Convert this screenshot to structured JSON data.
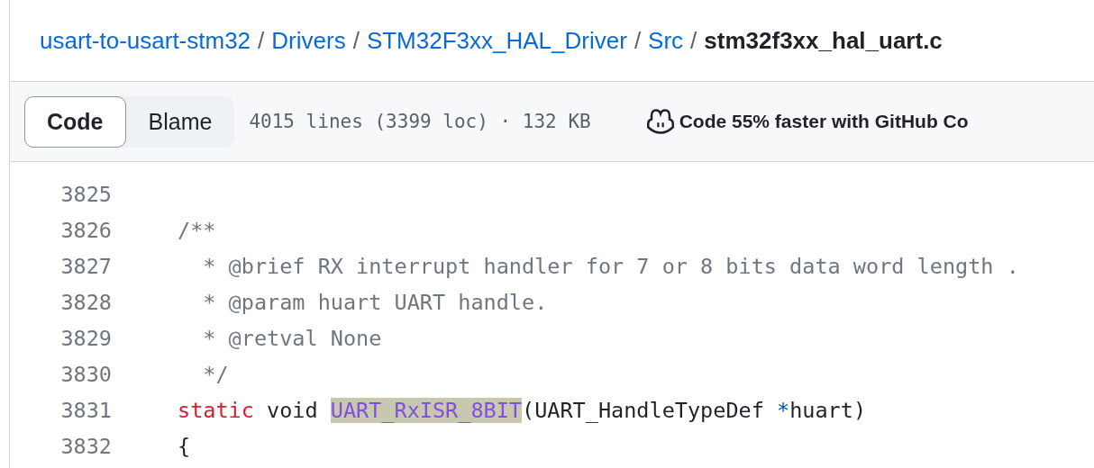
{
  "breadcrumb": [
    {
      "label": "usart-to-usart-stm32",
      "kind": "link"
    },
    {
      "label": "Drivers",
      "kind": "link"
    },
    {
      "label": "STM32F3xx_HAL_Driver",
      "kind": "link"
    },
    {
      "label": "Src",
      "kind": "link"
    },
    {
      "label": "stm32f3xx_hal_uart.c",
      "kind": "current"
    }
  ],
  "breadcrumb_separator": "/",
  "view_tabs": [
    {
      "label": "Code",
      "selected": true
    },
    {
      "label": "Blame",
      "selected": false
    }
  ],
  "file_info": "4015 lines (3399 loc) · 132 KB",
  "copilot_promo": "Code 55% faster with GitHub Co",
  "code_lines": [
    {
      "number": "3825"
    },
    {
      "number": "3826",
      "tokens": [
        {
          "text": "/**",
          "kind": "comment"
        }
      ]
    },
    {
      "number": "3827",
      "tokens": [
        {
          "text": "  * @brief RX interrupt handler for 7 or 8 bits data word length .",
          "kind": "comment"
        }
      ]
    },
    {
      "number": "3828",
      "tokens": [
        {
          "text": "  * @param huart UART handle.",
          "kind": "comment"
        }
      ]
    },
    {
      "number": "3829",
      "tokens": [
        {
          "text": "  * @retval None",
          "kind": "comment"
        }
      ]
    },
    {
      "number": "3830",
      "tokens": [
        {
          "text": "  */",
          "kind": "comment"
        }
      ]
    },
    {
      "number": "3831",
      "tokens": [
        {
          "text": "static",
          "kind": "keyword"
        },
        {
          "text": " void ",
          "kind": "plain"
        },
        {
          "text": "UART_RxISR_8BIT",
          "kind": "entity",
          "highlighted": true
        },
        {
          "text": "(UART_HandleTypeDef ",
          "kind": "plain"
        },
        {
          "text": "*",
          "kind": "operator"
        },
        {
          "text": "huart)",
          "kind": "plain"
        }
      ]
    },
    {
      "number": "3832",
      "tokens": [
        {
          "text": "{",
          "kind": "plain"
        }
      ]
    }
  ]
}
